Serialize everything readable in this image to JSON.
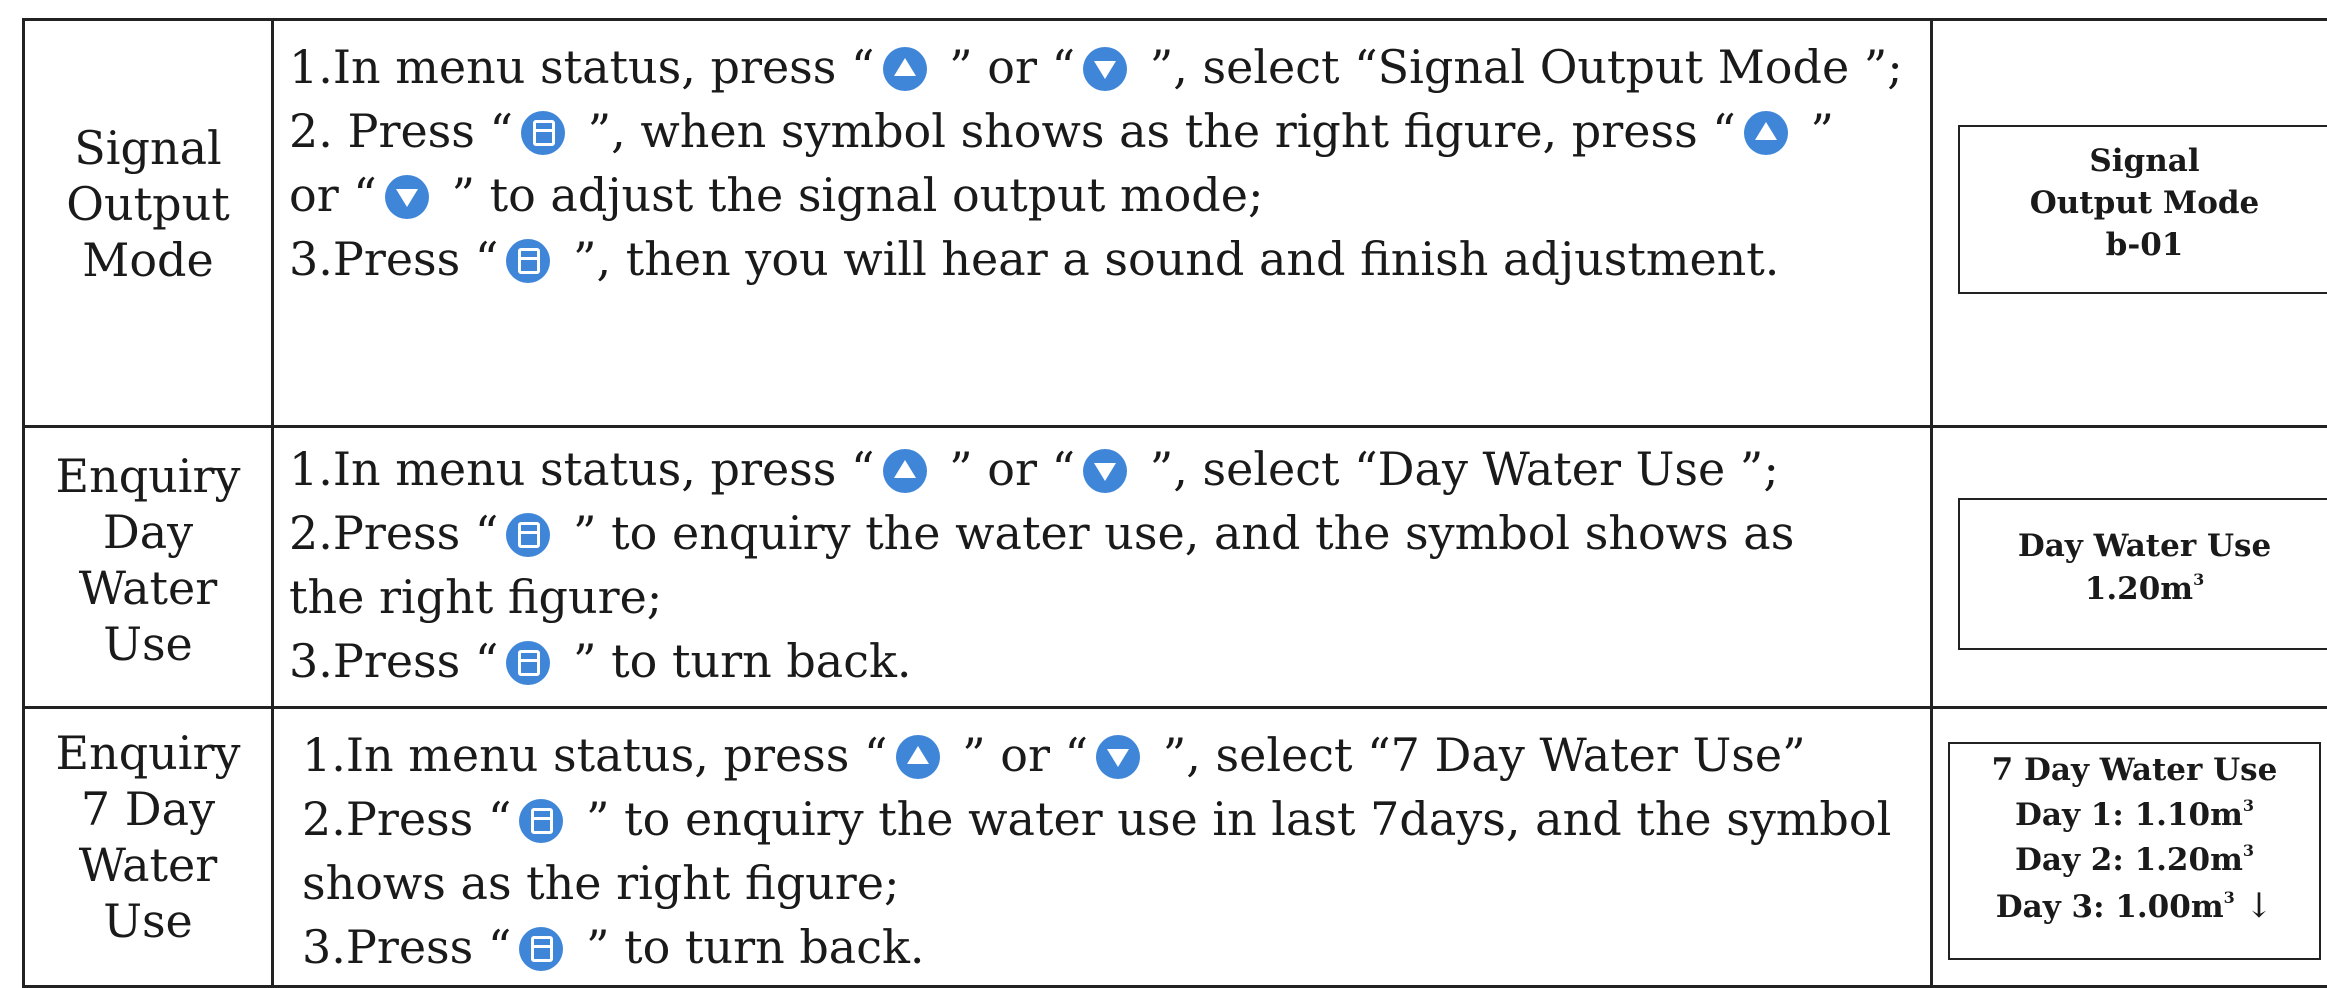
{
  "rows": [
    {
      "name": [
        "Signal",
        "Output",
        "Mode"
      ],
      "lines": [
        [
          "1.In menu status, press “",
          "up",
          " ” or “",
          "down",
          " ”, select “Signal Output Mode ”;"
        ],
        [
          "2. Press “",
          "menu",
          " ”, when symbol shows as the right figure, press “",
          "up",
          " ”"
        ],
        [
          "or “",
          "down",
          " ” to adjust the signal output mode;"
        ],
        [
          "3.Press “",
          "menu",
          " ”, then you will hear a sound and finish adjustment."
        ]
      ],
      "screen": [
        "Signal",
        "Output Mode",
        "b-01"
      ]
    },
    {
      "name": [
        "Enquiry",
        "Day",
        "Water",
        "Use"
      ],
      "lines": [
        [
          "1.In menu status, press “",
          "up",
          " ” or “",
          "down",
          " ”, select “Day Water Use ”;"
        ],
        [
          "2.Press “",
          "menu",
          " ” to enquiry the water use, and the symbol shows as"
        ],
        [
          "the right figure;"
        ],
        [
          "3.Press “",
          "menu",
          " ” to turn back."
        ]
      ],
      "screen": [
        "Day Water Use",
        "1.20m"
      ]
    },
    {
      "name": [
        "Enquiry",
        "7 Day",
        "Water",
        "Use"
      ],
      "lines": [
        [
          "1.In menu status, press “",
          "up",
          " ” or “",
          "down",
          " ”, select “7 Day Water Use”"
        ],
        [
          "2.Press “",
          "menu",
          " ” to enquiry the water use in last 7days, and the symbol"
        ],
        [
          "shows as the right figure;"
        ],
        [
          "3.Press “",
          "menu",
          " ” to turn back."
        ]
      ],
      "screen": [
        "7 Day Water Use",
        "Day 1: 1.10m",
        "Day 2: 1.20m",
        "Day 3: 1.00m"
      ]
    }
  ],
  "icons": {
    "up": "up-arrow-button-icon",
    "down": "down-arrow-button-icon",
    "menu": "menu-button-icon"
  },
  "accent_color": "#3f86d9",
  "unit_superscript": "3",
  "scroll_arrow": "↓"
}
